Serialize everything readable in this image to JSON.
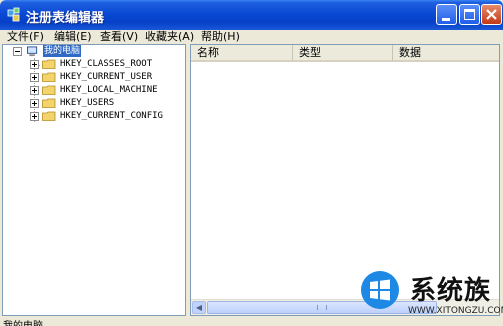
{
  "window": {
    "title": "注册表编辑器"
  },
  "menu": [
    {
      "label": "文件(F)"
    },
    {
      "label": "编辑(E)"
    },
    {
      "label": "查看(V)"
    },
    {
      "label": "收藏夹(A)"
    },
    {
      "label": "帮助(H)"
    }
  ],
  "tree": {
    "root": {
      "label": "我的电脑",
      "selected": true,
      "expanded": true
    },
    "children": [
      {
        "label": "HKEY_CLASSES_ROOT"
      },
      {
        "label": "HKEY_CURRENT_USER"
      },
      {
        "label": "HKEY_LOCAL_MACHINE"
      },
      {
        "label": "HKEY_USERS"
      },
      {
        "label": "HKEY_CURRENT_CONFIG"
      }
    ]
  },
  "list": {
    "columns": [
      {
        "label": "名称"
      },
      {
        "label": "类型"
      },
      {
        "label": "数据"
      }
    ]
  },
  "statusbar": {
    "text": "我的电脑"
  },
  "watermark": {
    "brand": "系统族",
    "url": "WWW.XITONGZU.COM"
  },
  "colors": {
    "titlebar": "#0a49d4",
    "selection": "#316ac5",
    "chrome": "#ece9d8",
    "close_button": "#c43a17"
  }
}
